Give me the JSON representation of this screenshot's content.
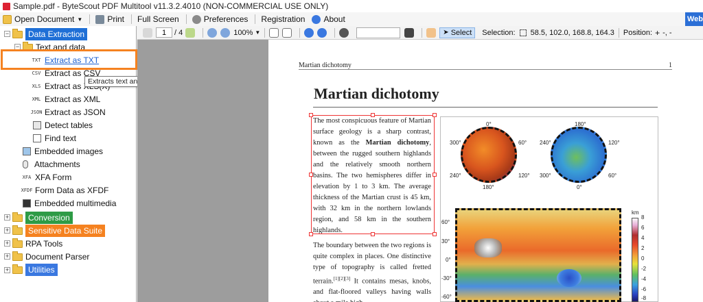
{
  "window": {
    "title": "Sample.pdf - ByteScout PDF Multitool v11.3.2.4010 (NON-COMMERCIAL USE ONLY)"
  },
  "menu": {
    "open_document": "Open Document",
    "print": "Print",
    "full_screen": "Full Screen",
    "preferences": "Preferences",
    "registration": "Registration",
    "about": "About",
    "web_tab": "Web"
  },
  "tree": {
    "data_extraction": "Data Extraction",
    "text_and_data": "Text and data",
    "extract_txt": "Extract as TXT",
    "extract_csv": "Extract as CSV",
    "extract_xls": "Extract as XLS(X)",
    "extract_xml": "Extract as XML",
    "extract_json": "Extract as JSON",
    "detect_tables": "Detect tables",
    "find_text": "Find text",
    "embedded_images": "Embedded images",
    "attachments": "Attachments",
    "xfa_form": "XFA Form",
    "form_data_xfdf": "Form Data as XFDF",
    "embedded_multimedia": "Embedded multimedia",
    "conversion": "Conversion",
    "sensitive_data_suite": "Sensitive Data Suite",
    "rpa_tools": "RPA Tools",
    "document_parser": "Document Parser",
    "utilities": "Utilities",
    "file_icons": {
      "txt": "TXT",
      "csv": "CSV",
      "xls": "XLS",
      "xml": "XML",
      "json": "JSON",
      "xfa": "XFA",
      "xfdf": "XFDF"
    },
    "tooltip": "Extracts text and table data to plain text format (TXT)"
  },
  "colors": {
    "data_extraction": "#1f6fd6",
    "conversion": "#2e9b46",
    "sensitive_data_suite": "#f58220",
    "utilities": "#3a78e0",
    "highlight": "#f58220"
  },
  "viewer": {
    "page_current": "1",
    "page_total": "/ 4",
    "zoom": "100%",
    "select_label": "Select",
    "selection_label": "Selection:",
    "selection_value": "58.5, 102.0, 168.8, 164.3",
    "position_label": "Position:",
    "position_value": "-, -"
  },
  "document": {
    "running_header": "Martian dichotomy",
    "page_number": "1",
    "title": "Martian dichotomy",
    "para1_a": "The most conspicuous feature of Martian surface geology is a sharp contrast, known as the ",
    "para1_bold": "Martian dichotomy",
    "para1_b": ", between the rugged southern highlands and the relatively smooth northern basins. The two hemispheres differ in elevation by 1 to 3 km. The average thickness of the Martian crust is 45 km, with 32 km in the northern lowlands region, and 58 km in the southern highlands.",
    "para2_a": "The boundary between the two regions is quite complex in places. One distinctive type of topography is called fretted terrain.",
    "para2_cite": "[1][2][3]",
    "para2_b": " It contains mesas, knobs, and flat-floored valleys having walls about a mile high"
  },
  "figure": {
    "globe1_labels": {
      "top": "0°",
      "bottom": "180°",
      "left_top": "300°",
      "left_bottom": "240°",
      "right_top": "60°",
      "right_bottom": "120°"
    },
    "globe2_labels": {
      "top": "180°",
      "bottom": "0°",
      "left_top": "240°",
      "left_bottom": "300°",
      "right_top": "120°",
      "right_bottom": "60°"
    },
    "lat_labels": [
      "60°",
      "30°",
      "0°",
      "-30°",
      "-60°"
    ],
    "colorbar_unit": "km",
    "colorbar_ticks": [
      "8",
      "6",
      "4",
      "2",
      "0",
      "-2",
      "-4",
      "-6",
      "-8"
    ]
  }
}
